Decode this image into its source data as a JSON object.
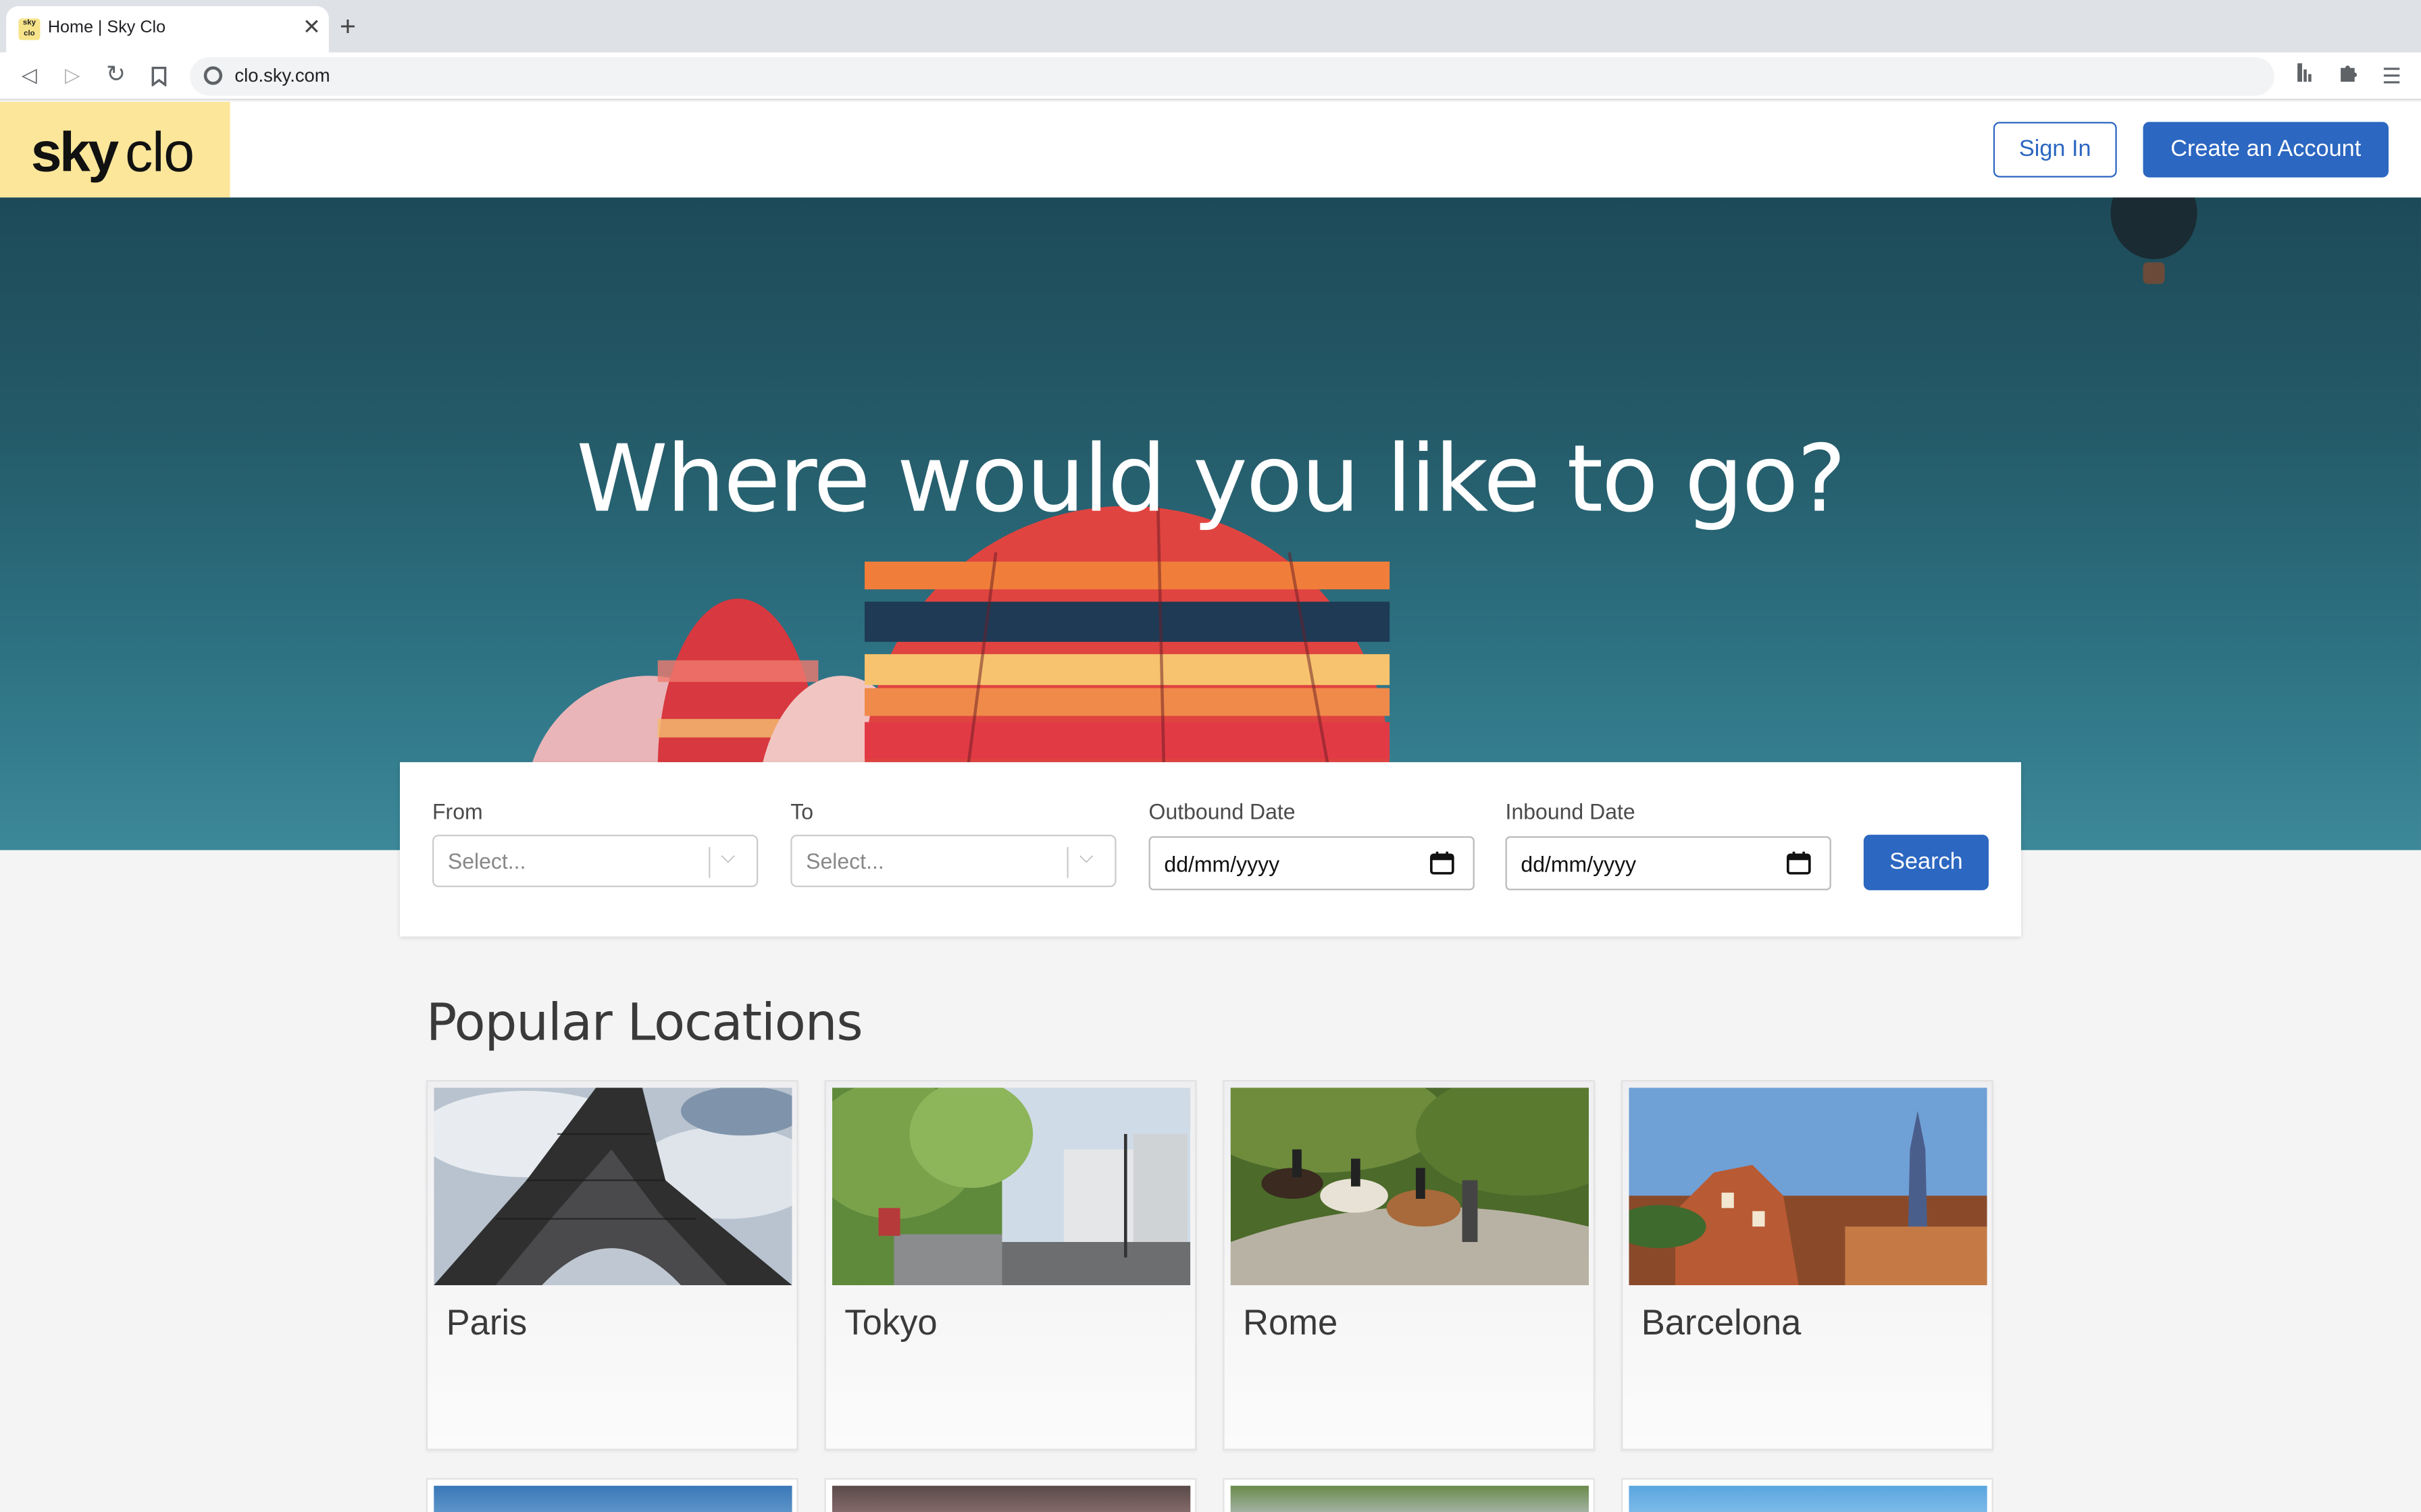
{
  "browser": {
    "tab_title": "Home | Sky Clo",
    "favicon_text": "sky clo",
    "url": "clo.sky.com"
  },
  "header": {
    "logo_sky": "sky",
    "logo_clo": "clo",
    "sign_in_label": "Sign In",
    "create_account_label": "Create an Account"
  },
  "hero": {
    "title": "Where would you like to go?"
  },
  "search": {
    "from_label": "From",
    "from_placeholder": "Select...",
    "to_label": "To",
    "to_placeholder": "Select...",
    "outbound_label": "Outbound Date",
    "outbound_value": "dd/mm/yyyy",
    "inbound_label": "Inbound Date",
    "inbound_value": "dd/mm/yyyy",
    "search_label": "Search"
  },
  "popular": {
    "title": "Popular Locations",
    "locations": [
      {
        "name": "Paris"
      },
      {
        "name": "Tokyo"
      },
      {
        "name": "Rome"
      },
      {
        "name": "Barcelona"
      }
    ]
  },
  "colors": {
    "brand_blue": "#2c67c1",
    "logo_yellow": "#fbe69a",
    "hero_teal": "#245a68"
  }
}
